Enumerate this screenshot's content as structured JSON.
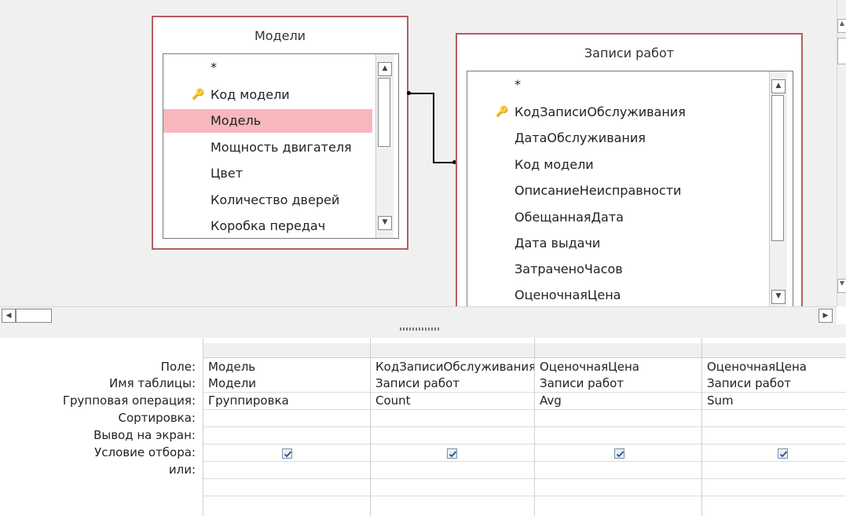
{
  "tables": {
    "models": {
      "title": "Модели",
      "fields": [
        "*",
        "Код модели",
        "Модель",
        "Мощность двигателя",
        "Цвет",
        "Количество дверей",
        "Коробка передач"
      ]
    },
    "records": {
      "title": "Записи работ",
      "fields": [
        "*",
        "КодЗаписиОбслуживания",
        "ДатаОбслуживания",
        "Код модели",
        "ОписаниеНеисправности",
        "ОбещаннаяДата",
        "Дата выдачи",
        "ЗатраченоЧасов",
        "ОценочнаяЦена"
      ]
    }
  },
  "grid": {
    "row_labels": [
      "Поле:",
      "Имя таблицы:",
      "Групповая операция:",
      "Сортировка:",
      "Вывод на экран:",
      "Условие отбора:",
      "или:"
    ],
    "columns": [
      {
        "field": "Модель",
        "table": "Модели",
        "operation": "Группировка",
        "sort": "",
        "show": true
      },
      {
        "field": "КодЗаписиОбслуживания",
        "table": "Записи работ",
        "operation": "Count",
        "sort": "",
        "show": true
      },
      {
        "field": "ОценочнаяЦена",
        "table": "Записи работ",
        "operation": "Avg",
        "sort": "",
        "show": true
      },
      {
        "field": "ОценочнаяЦена",
        "table": "Записи работ",
        "operation": "Sum",
        "sort": "",
        "show": true
      }
    ]
  },
  "icons": {
    "key": "key-icon",
    "checkbox": "checkmark-icon"
  }
}
